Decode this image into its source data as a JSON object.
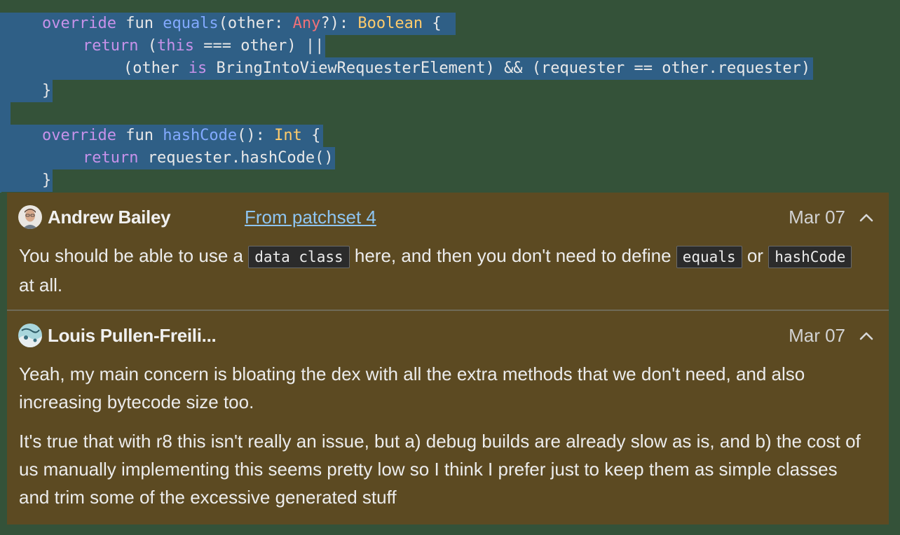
{
  "code": {
    "line1": {
      "t1": "override",
      "t2": " fun ",
      "t3": "equals",
      "t4": "(other: ",
      "t5": "Any",
      "t6": "?): ",
      "t7": "Boolean",
      "t8": " {"
    },
    "line2": {
      "t1": "return",
      "t2": " (",
      "t3": "this",
      "t4": " === other) ||"
    },
    "line3": {
      "t1": "(other ",
      "t2": "is",
      "t3": " BringIntoViewRequesterElement) && (requester == other.requester)"
    },
    "line4": {
      "t1": "}"
    },
    "line5": {
      "t1": "override",
      "t2": " fun ",
      "t3": "hashCode",
      "t4": "(): ",
      "t5": "Int",
      "t6": " {"
    },
    "line6": {
      "t1": "return",
      "t2": " requester.hashCode()"
    },
    "line7": {
      "t1": "}"
    }
  },
  "comments": [
    {
      "author": "Andrew Bailey",
      "patchset_link": "From patchset 4",
      "date": "Mar 07",
      "body": {
        "s1": "You should be able to use a ",
        "code1": "data class",
        "s2": " here, and then you don't need to define ",
        "code2": "equals",
        "s3": " or ",
        "code3": "hashCode",
        "s4": " at all."
      }
    },
    {
      "author": "Louis Pullen-Freili...",
      "date": "Mar 07",
      "p1": "Yeah, my main concern is bloating the dex with all the extra methods that we don't need, and also increasing bytecode size too.",
      "p2": "It's true that with r8 this isn't really an issue, but a) debug builds are already slow as is, and b) the cost of us manually implementing this seems pretty low so I think I prefer just to keep them as simple classes and trim some of the excessive generated stuff"
    }
  ],
  "colors": {
    "code_bg": "#345239",
    "selection": "#2f5f86",
    "comment_bg": "#5c4a22",
    "link": "#8ec5f2"
  },
  "icons": [
    "avatar-andrew",
    "avatar-louis",
    "chevron-up-icon"
  ]
}
